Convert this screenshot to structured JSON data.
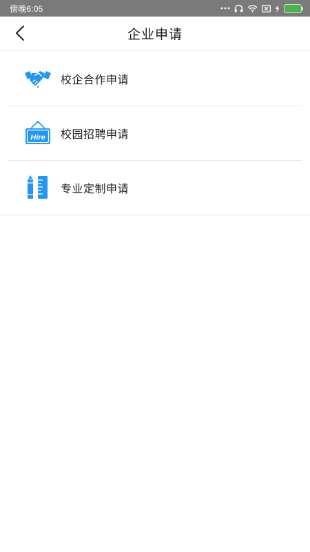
{
  "status_bar": {
    "time": "傍晚6:05",
    "icons": [
      "more-dots-icon",
      "headphones-icon",
      "wifi-icon",
      "sim-off-icon",
      "charging-icon",
      "battery-icon"
    ]
  },
  "header": {
    "title": "企业申请",
    "back_icon": "chevron-left-icon"
  },
  "menu": {
    "items": [
      {
        "label": "校企合作申请",
        "icon": "handshake-icon"
      },
      {
        "label": "校园招聘申请",
        "icon": "hire-sign-icon"
      },
      {
        "label": "专业定制申请",
        "icon": "pencil-ruler-icon"
      }
    ]
  },
  "colors": {
    "accent": "#2196f3",
    "status_bar": "#7a7a7a",
    "battery": "#4caf50"
  }
}
